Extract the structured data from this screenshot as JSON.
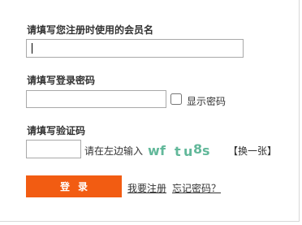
{
  "form": {
    "username_label": "请填写您注册时使用的会员名",
    "username_value": "",
    "password_label": "请填写登录密码",
    "password_value": "",
    "show_password_label": "显示密码",
    "captcha_label": "请填写验证码",
    "captcha_value": "",
    "captcha_hint": "请在左边输入",
    "captcha_chars": [
      "w",
      "f",
      "t",
      "u",
      "8",
      "s"
    ],
    "refresh_label": "【换一张】",
    "login_button": "登录",
    "register_link": "我要注册",
    "forgot_link": "忘记密码？"
  },
  "colors": {
    "accent": "#f25c12",
    "captcha_text": "#62b89a"
  }
}
